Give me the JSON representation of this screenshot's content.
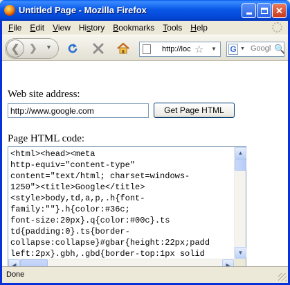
{
  "window": {
    "title": "Untitled Page - Mozilla Firefox"
  },
  "menubar": {
    "items": [
      {
        "accel": "F",
        "rest": "ile"
      },
      {
        "accel": "E",
        "rest": "dit"
      },
      {
        "accel": "V",
        "rest": "iew"
      },
      {
        "accel": "",
        "pre": "Hi",
        "accel2": "s",
        "rest": "tory"
      },
      {
        "accel": "B",
        "rest": "ookmarks"
      },
      {
        "accel": "T",
        "rest": "ools"
      },
      {
        "accel": "H",
        "rest": "elp"
      }
    ]
  },
  "navbar": {
    "url_text": "http://loc",
    "search_placeholder": "Googl"
  },
  "form": {
    "address_label": "Web site address:",
    "address_value": "http://www.google.com",
    "get_button": "Get Page HTML",
    "code_label": "Page HTML code:",
    "code_value": "<html><head><meta\nhttp-equiv=\"content-type\"\ncontent=\"text/html; charset=windows-\n1250\"><title>Google</title>\n<style>body,td,a,p,.h{font-\nfamily:\"\"}.h{color:#36c;\nfont-size:20px}.q{color:#00c}.ts\ntd{padding:0}.ts{border-\ncollapse:collapse}#gbar{height:22px;padd\nleft:2px}.gbh,.gbd{border-top:1px solid"
  },
  "statusbar": {
    "text": "Done"
  }
}
